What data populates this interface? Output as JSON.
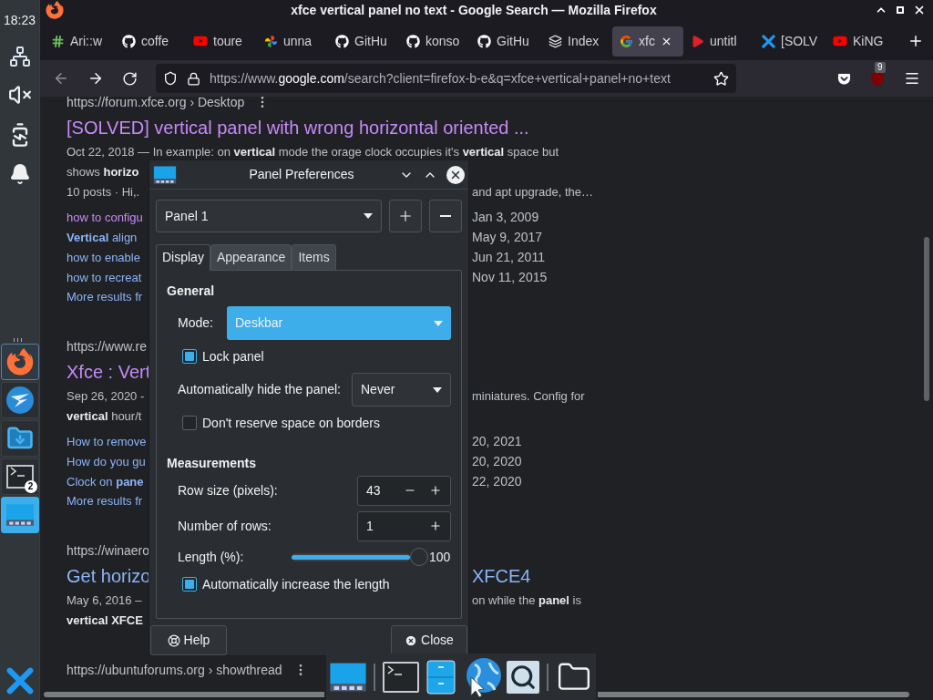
{
  "left_panel": {
    "clock": "18:23",
    "launchers": [
      {
        "kind": "firefox",
        "selected": false,
        "focused": true
      },
      {
        "kind": "bird",
        "selected": false,
        "focused": false
      },
      {
        "kind": "folder",
        "selected": false,
        "focused": false
      },
      {
        "kind": "terminal",
        "selected": false,
        "focused": false,
        "badge": "2"
      },
      {
        "kind": "panel",
        "selected": true,
        "focused": false
      }
    ]
  },
  "firefox": {
    "title": "xfce vertical panel no text - Google Search — Mozilla Firefox",
    "tabs": [
      {
        "label": "Ari::w",
        "selected": false
      },
      {
        "label": "coffe",
        "selected": false
      },
      {
        "label": "toure",
        "selected": false
      },
      {
        "label": "unna",
        "selected": false
      },
      {
        "label": "GitHu",
        "selected": false
      },
      {
        "label": "konso",
        "selected": false
      },
      {
        "label": "GitHu",
        "selected": false
      },
      {
        "label": "Index",
        "selected": false
      },
      {
        "label": "xfc",
        "selected": true
      },
      {
        "label": "untitl",
        "selected": false
      },
      {
        "label": "[SOLV",
        "selected": false
      },
      {
        "label": "KiNG",
        "selected": false
      }
    ],
    "url_prefix": "https://www.",
    "url_domain": "google.com",
    "url_path": "/search?client=firefox-b-e&q=xfce+vertical+panel+no+text",
    "extension_badge": "9"
  },
  "results": [
    {
      "url": "https://forum.xfce.org › Desktop",
      "url_menu": true,
      "title": {
        "left": "[SOLVED] vertical panel with wrong horizontal oriented ...",
        "visited": true
      },
      "snippet": [
        {
          "left": "Oct 22, 2018 — In example: on **vertical** mode the orage clock occupies it's **vertical** space but"
        },
        {
          "left": "shows **horizo**"
        },
        {
          "left": "10 posts · Hi,.",
          "right": "and apt upgrade, the…"
        }
      ],
      "links": [
        {
          "left": "how to configu",
          "right": "Jan 3, 2009",
          "visited": true
        },
        {
          "left": "**Vertical** align",
          "right": "May 9, 2017",
          "visited": false
        },
        {
          "left": "how to enable",
          "right": "Jun 21, 2011",
          "visited": false
        },
        {
          "left": "how to recreat",
          "right": "Nov 11, 2015",
          "visited": false
        }
      ],
      "more": "More results fr"
    },
    {
      "url": "https://www.re",
      "title": {
        "left": "Xfce : Vert",
        "visited": true
      },
      "snippet": [
        {
          "left": "Sep 26, 2020 -",
          "right": "miniatures. Config for"
        },
        {
          "left": "**vertical** hour/t"
        }
      ],
      "links": [
        {
          "left": "How to remove",
          "right": "20, 2021",
          "visited": false
        },
        {
          "left": "How do you gu",
          "right": "20, 2020",
          "visited": false
        },
        {
          "left": "Clock on **pane**",
          "right": "22, 2020",
          "visited": false
        }
      ],
      "more": "More results fr"
    },
    {
      "url": "https://winaero",
      "title": {
        "left": "Get horizo",
        "right": "XFCE4",
        "visited": false
      },
      "snippet": [
        {
          "left": "May 6, 2016 –",
          "right": "on while the **panel** is"
        },
        {
          "left": "**vertical XFCE**"
        }
      ]
    },
    {
      "url": "https://ubuntuforums.org › showthread",
      "url_menu": true
    }
  ],
  "dialog": {
    "title": "Panel Preferences",
    "panel": "Panel 1",
    "tabs": [
      {
        "label": "Display",
        "selected": true
      },
      {
        "label": "Appearance",
        "selected": false
      },
      {
        "label": "Items",
        "selected": false
      }
    ],
    "general": "General",
    "mode_label": "Mode:",
    "mode": "Deskbar",
    "lock_label": "Lock panel",
    "lock_checked": true,
    "hide_label": "Automatically hide the panel:",
    "hide": "Never",
    "reserve_label": "Don't reserve space on borders",
    "reserve_checked": false,
    "measurements": "Measurements",
    "row_size_label": "Row size (pixels):",
    "row_size": "43",
    "rows_label": "Number of rows:",
    "rows": "1",
    "length_label": "Length (%):",
    "length": {
      "level": 1,
      "reading": "100"
    },
    "auto_label": "Automatically increase the length",
    "auto_checked": true,
    "help": "Help",
    "close": "Close"
  },
  "dock": [
    {
      "kind": "panel"
    },
    {
      "kind": "separator"
    },
    {
      "kind": "terminal"
    },
    {
      "kind": "cabinet"
    },
    {
      "kind": "globe"
    },
    {
      "kind": "search"
    },
    {
      "kind": "separator"
    },
    {
      "kind": "folder"
    }
  ]
}
